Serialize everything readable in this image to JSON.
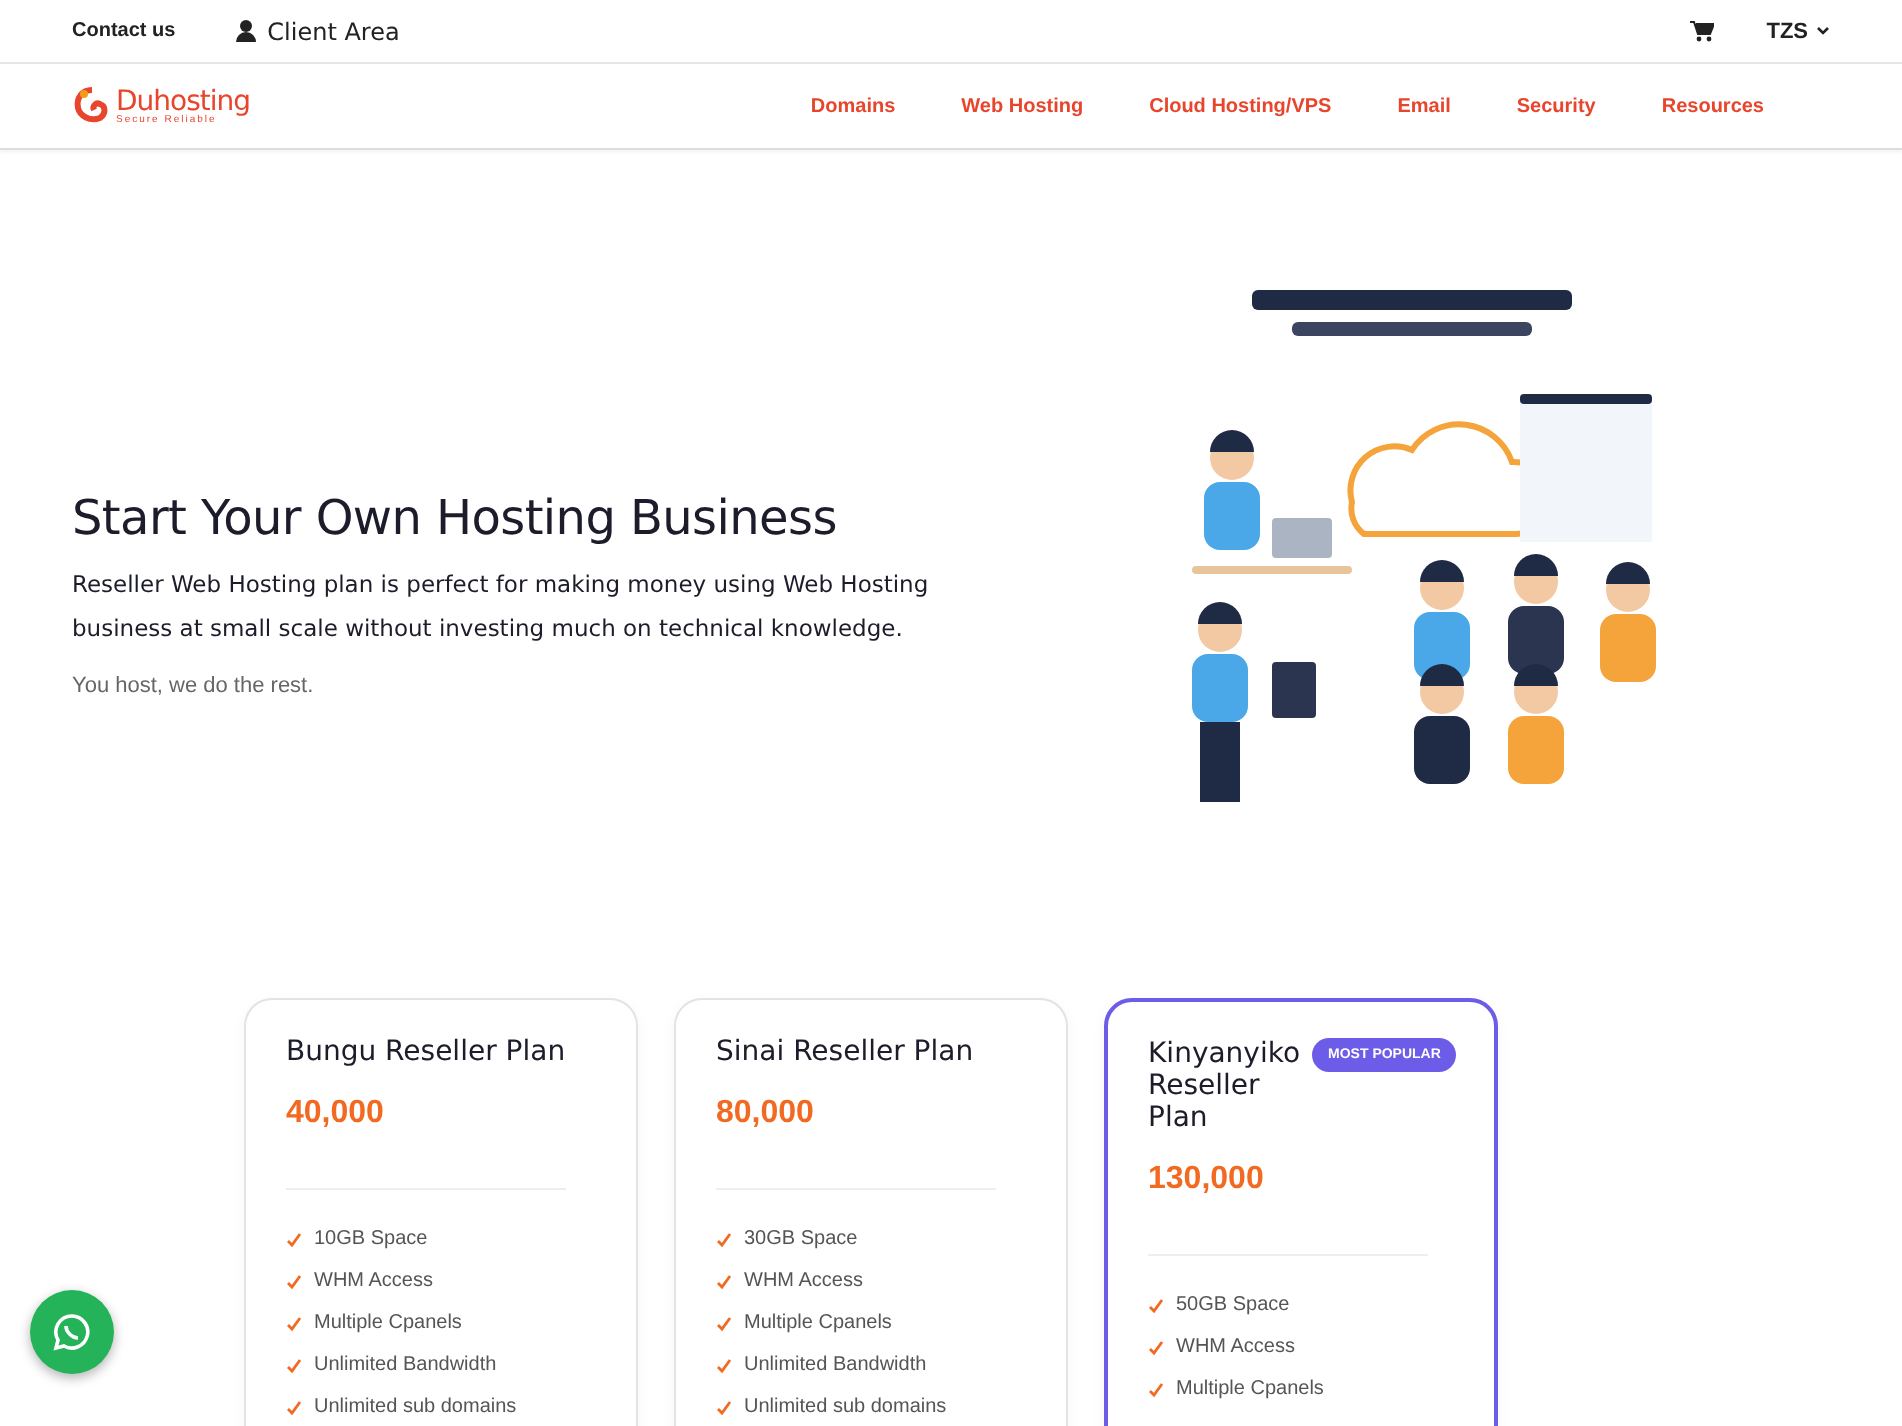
{
  "topbar": {
    "contact": "Contact us",
    "client_area": "Client Area",
    "currency": "TZS"
  },
  "logo": {
    "name": "Duhosting",
    "tagline": "Secure Reliable"
  },
  "nav": [
    {
      "label": "Domains"
    },
    {
      "label": "Web Hosting"
    },
    {
      "label": "Cloud Hosting/VPS"
    },
    {
      "label": "Email"
    },
    {
      "label": "Security"
    },
    {
      "label": "Resources"
    }
  ],
  "hero": {
    "title": "Start Your Own Hosting Business",
    "lead": "Reseller Web Hosting plan is perfect for making money using Web Hosting business at small scale without investing much on technical knowledge.",
    "note": "You host, we do the rest."
  },
  "plans": [
    {
      "name": "Bungu Reseller Plan",
      "price": "40,000",
      "popular": false,
      "features": [
        "10GB Space",
        "WHM Access",
        "Multiple Cpanels",
        "Unlimited Bandwidth",
        "Unlimited sub domains"
      ]
    },
    {
      "name": "Sinai Reseller Plan",
      "price": "80,000",
      "popular": false,
      "features": [
        "30GB Space",
        "WHM Access",
        "Multiple Cpanels",
        "Unlimited Bandwidth",
        "Unlimited sub domains"
      ]
    },
    {
      "name": "Kinyanyiko Reseller Plan",
      "price": "130,000",
      "popular": true,
      "badge": "MOST POPULAR",
      "features": [
        "50GB Space",
        "WHM Access",
        "Multiple Cpanels"
      ]
    }
  ]
}
